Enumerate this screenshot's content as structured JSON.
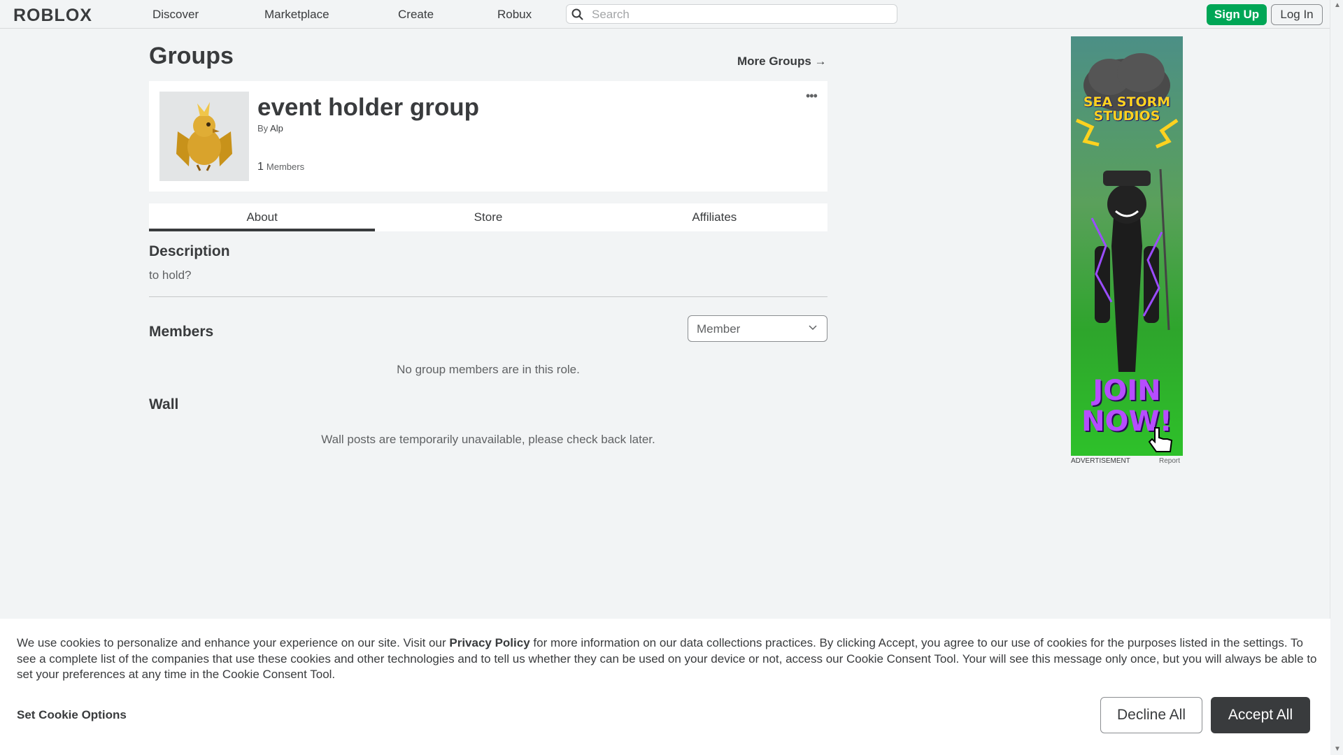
{
  "nav": {
    "logo": "ROBLOX",
    "links": [
      "Discover",
      "Marketplace",
      "Create",
      "Robux"
    ],
    "search_placeholder": "Search",
    "signup": "Sign Up",
    "login": "Log In"
  },
  "page": {
    "title": "Groups",
    "more_groups": "More Groups →"
  },
  "group": {
    "name": "event holder group",
    "by_label": "By",
    "owner": "Alp",
    "member_count": "1",
    "members_label": "Members",
    "menu_glyph": "•••"
  },
  "tabs": [
    "About",
    "Store",
    "Affiliates"
  ],
  "about": {
    "description_heading": "Description",
    "description": "to hold?",
    "members_heading": "Members",
    "role_selected": "Member",
    "members_empty": "No group members are in this role.",
    "wall_heading": "Wall",
    "wall_empty": "Wall posts are temporarily unavailable, please check back later."
  },
  "ad": {
    "label": "ADVERTISEMENT",
    "report": "Report",
    "brand_line1": "SEA STORM",
    "brand_line2": "STUDIOS",
    "cta_line1": "JOIN",
    "cta_line2": "NOW!"
  },
  "cookie": {
    "text_before": "We use cookies to personalize and enhance your experience on our site. Visit our ",
    "privacy_link": "Privacy Policy",
    "text_after": " for more information on our data collections practices. By clicking Accept, you agree to our use of cookies for the purposes listed in the settings. To see a complete list of the companies that use these cookies and other technologies and to tell us whether they can be used on your device or not, access our Cookie Consent Tool. Your will see this message only once, but you will always be able to set your preferences at any time in the Cookie Consent Tool.",
    "set_options": "Set Cookie Options",
    "decline": "Decline All",
    "accept": "Accept All"
  },
  "colors": {
    "accent_green": "#00a656",
    "text_dark": "#393b3d",
    "page_bg": "#f2f4f5"
  }
}
